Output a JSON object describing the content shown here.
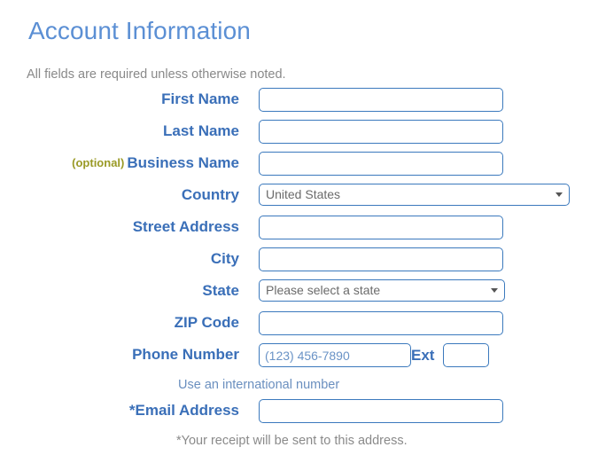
{
  "header": {
    "title": "Account Information",
    "subtitle": "All fields are required unless otherwise noted."
  },
  "colors": {
    "title_blue": "#5b8fd4",
    "label_blue": "#3a6fb8",
    "border_blue": "#3b79bd",
    "optional_olive": "#9a9a26",
    "note_gray": "#8a8a8a",
    "note_link_blue": "#6a8fbf",
    "placeholder_blue": "#6a93c6"
  },
  "form": {
    "first_name": {
      "label": "First Name",
      "value": "",
      "placeholder": ""
    },
    "last_name": {
      "label": "Last Name",
      "value": "",
      "placeholder": ""
    },
    "business_name": {
      "optional_tag": "(optional)",
      "label": "Business Name",
      "value": "",
      "placeholder": ""
    },
    "country": {
      "label": "Country",
      "selected": "United States",
      "options": [
        "United States"
      ],
      "arrow_icon": "chevron-down-icon"
    },
    "street_address": {
      "label": "Street Address",
      "value": "",
      "placeholder": ""
    },
    "city": {
      "label": "City",
      "value": "",
      "placeholder": ""
    },
    "state": {
      "label": "State",
      "selected": "Please select a state",
      "options": [
        "Please select a state"
      ],
      "arrow_icon": "chevron-down-icon"
    },
    "zip_code": {
      "label": "ZIP Code",
      "value": "",
      "placeholder": ""
    },
    "phone_number": {
      "label": "Phone Number",
      "value": "",
      "placeholder": "(123) 456-7890",
      "ext_label": "Ext",
      "ext_value": "",
      "ext_placeholder": ""
    },
    "international_note": "Use an international number",
    "email_address": {
      "label": "*Email Address",
      "value": "",
      "placeholder": ""
    },
    "receipt_note": "*Your receipt will be sent to this address."
  }
}
